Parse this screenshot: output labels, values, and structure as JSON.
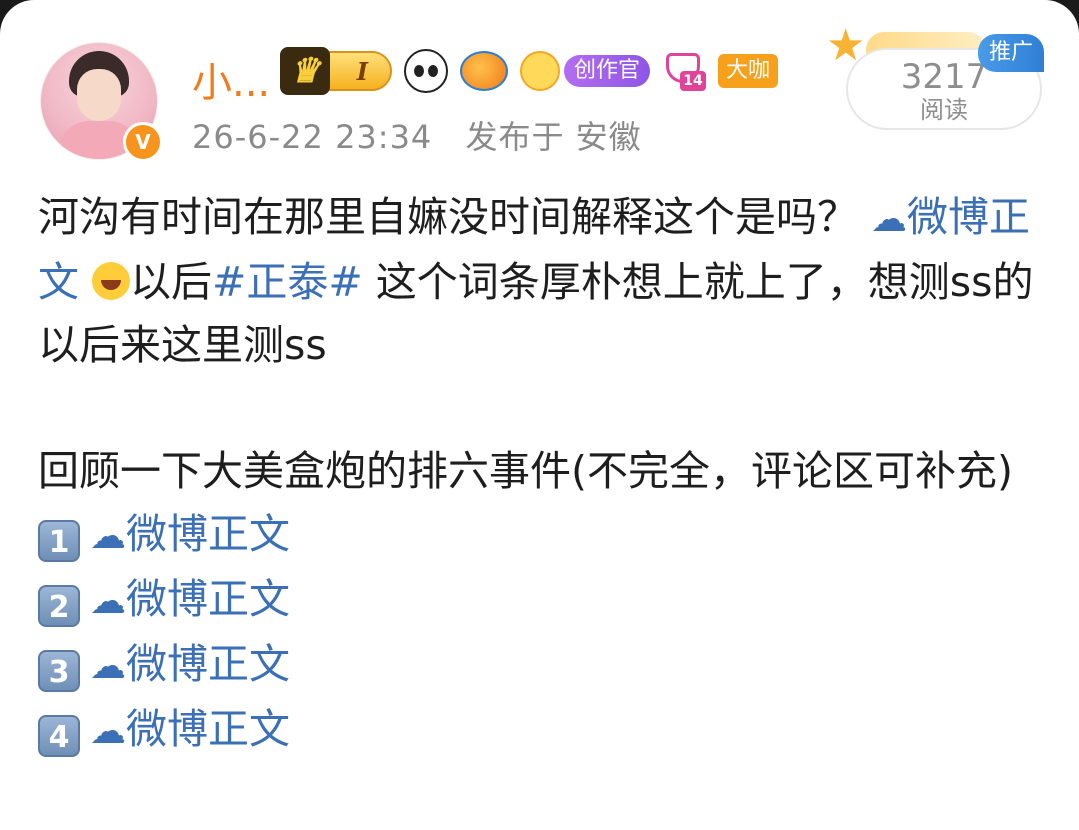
{
  "user": {
    "name": "小...",
    "level_badge": "I",
    "creator_label": "创作官",
    "gem_level": "14",
    "tier_label": "大咖",
    "verified": "V"
  },
  "meta": {
    "timestamp": "26-6-22 23:34",
    "location": "发布于 安徽"
  },
  "stats": {
    "read_count": "3217",
    "read_label": "阅读",
    "promo_label": "推广"
  },
  "post": {
    "line1_pre": "河沟有时间在那里自嫲没时间解释这个是吗？",
    "weibo_link": "微博正文",
    "line2_mid": "以后",
    "hashtag": "#正泰#",
    "line2_post": " 这个词条厚朴想上就上了，想测ss的以后来这里测ss",
    "para2": "回顾一下大美盒炮的排六事件(不完全，评论区可补充)",
    "items": [
      {
        "num": "1",
        "link": "微博正文"
      },
      {
        "num": "2",
        "link": "微博正文"
      },
      {
        "num": "3",
        "link": "微博正文"
      },
      {
        "num": "4",
        "link": "微博正文"
      }
    ]
  },
  "colors": {
    "username": "#f07c1c",
    "link": "#3b6fb6",
    "meta": "#8a8a8a",
    "promo": "#2f7fd6"
  },
  "icons": [
    "avatar-photo",
    "verified-icon",
    "crown-icon",
    "panda-icon",
    "fish-icon",
    "creator-face-icon",
    "gem-icon",
    "star-icon",
    "cloud-link-icon",
    "laughing-emoji-icon",
    "keycap-number-icon"
  ]
}
